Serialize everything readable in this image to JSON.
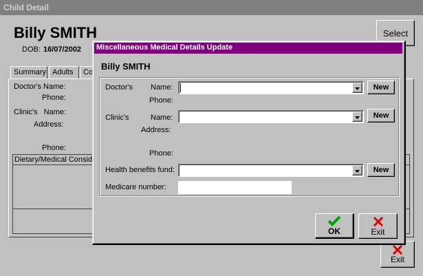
{
  "parent_window": {
    "title": "Child Detail",
    "title_bar_color": "#808080",
    "child_name": "Billy SMITH",
    "dob_label": "DOB:",
    "dob_value": "16/07/2002",
    "select_button": "Select",
    "exit_button": "Exit",
    "tabs": [
      {
        "label": "Summary"
      },
      {
        "label": "Adults"
      },
      {
        "label": "Co"
      }
    ],
    "doctor_name_label": "Doctor's Name:",
    "doctor_phone_label": "Phone:",
    "clinic_name_label": "Clinic's   Name:",
    "clinic_address_label": "Address:",
    "clinic_phone_label": "Phone:",
    "dietary_header": "Dietary/Medical Conside"
  },
  "dialog": {
    "title": "Miscellaneous Medical Details Update",
    "title_bar_color": "#800080",
    "child_name": "Billy SMITH",
    "doctor_label": "Doctor's",
    "doctor_name_label": "Name:",
    "doctor_phone_label": "Phone:",
    "doctor_name_value": "",
    "clinic_label": "Clinic's",
    "clinic_name_label": "Name:",
    "clinic_address_label": "Address:",
    "clinic_phone_label": "Phone:",
    "clinic_name_value": "",
    "health_fund_label": "Health benefits fund:",
    "health_fund_value": "",
    "medicare_label": "Medicare number:",
    "medicare_value": "",
    "new_button": "New",
    "ok_button": "OK",
    "exit_button": "Exit",
    "icons": {
      "ok": "checkmark-icon",
      "exit": "red-x-icon"
    }
  }
}
